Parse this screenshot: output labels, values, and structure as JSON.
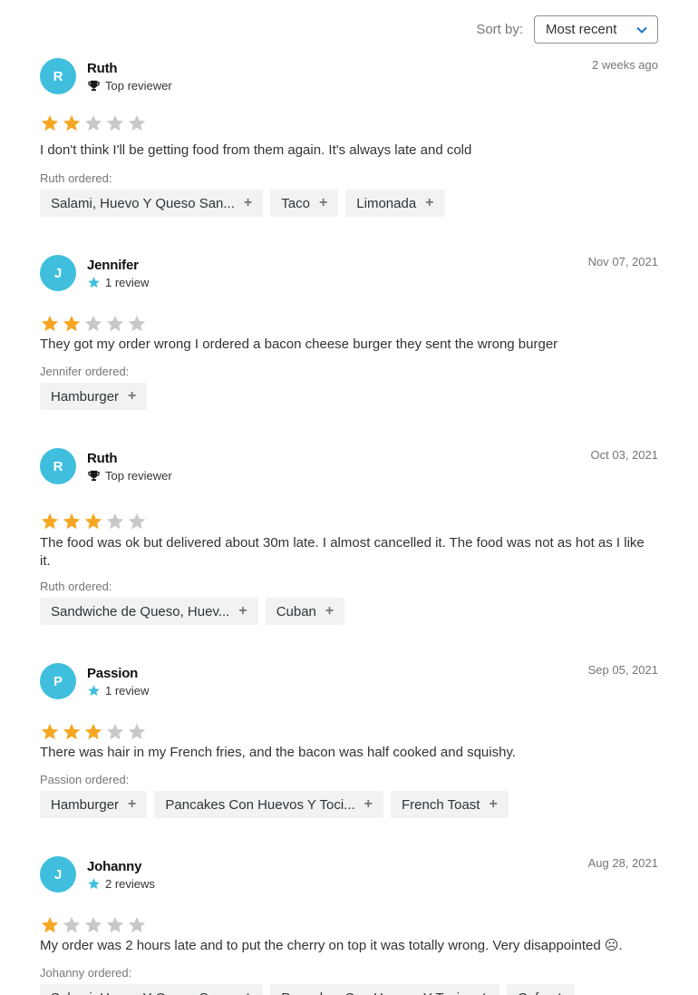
{
  "sort": {
    "label": "Sort by:",
    "value": "Most recent"
  },
  "colors": {
    "avatar": "#3fbfdd",
    "star_filled": "#f5a623",
    "star_empty": "#c8c8c8",
    "badge_star": "#3fbfdd"
  },
  "reviews": [
    {
      "initial": "R",
      "name": "Ruth",
      "badge_icon": "trophy-icon",
      "badge": "Top reviewer",
      "date": "2 weeks ago",
      "rating": 2,
      "text": "I don't think I'll be getting food from them again. It's always late and cold",
      "ordered_label": "Ruth ordered:",
      "items": [
        "Salami, Huevo Y Queso San...",
        "Taco",
        "Limonada"
      ]
    },
    {
      "initial": "J",
      "name": "Jennifer",
      "badge_icon": "star-icon",
      "badge": "1 review",
      "date": "Nov 07, 2021",
      "rating": 2,
      "text": "They got my order wrong I ordered a bacon cheese burger they sent the wrong burger",
      "ordered_label": "Jennifer ordered:",
      "items": [
        "Hamburger"
      ]
    },
    {
      "initial": "R",
      "name": "Ruth",
      "badge_icon": "trophy-icon",
      "badge": "Top reviewer",
      "date": "Oct 03, 2021",
      "rating": 3,
      "text": "The food was ok but delivered about 30m late. I almost cancelled it. The food was not as hot as I like it.",
      "ordered_label": "Ruth ordered:",
      "items": [
        "Sandwiche de Queso, Huev...",
        "Cuban"
      ]
    },
    {
      "initial": "P",
      "name": "Passion",
      "badge_icon": "star-icon",
      "badge": "1 review",
      "date": "Sep 05, 2021",
      "rating": 3,
      "text": "There was hair in my French fries, and the bacon was half cooked and squishy.",
      "ordered_label": "Passion ordered:",
      "items": [
        "Hamburger",
        "Pancakes Con Huevos Y Toci...",
        "French Toast"
      ]
    },
    {
      "initial": "J",
      "name": "Johanny",
      "badge_icon": "star-icon",
      "badge": "2 reviews",
      "date": "Aug 28, 2021",
      "rating": 1,
      "text": "My order was 2 hours late and to put the cherry on top it was totally wrong. Very disappointed ☹.",
      "ordered_label": "Johanny ordered:",
      "items": [
        "Salami, Huevo Y Queso San...",
        "Pancakes Con Huevos Y Toci...",
        "Cafe"
      ]
    }
  ]
}
